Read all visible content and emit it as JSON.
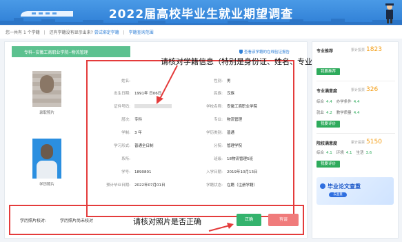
{
  "banner": {
    "title": "2022届高校毕业生就业期望调查"
  },
  "info_row": {
    "count_text": "您一共有",
    "count_num": "1",
    "count_unit": "个学籍",
    "missing_text": "还有学籍没有显示出来?",
    "bind_link": "尝试绑定学籍",
    "query_link": "学籍查询范围"
  },
  "card": {
    "ribbon": "专科--安徽工商职业学院--物流管理",
    "verify_link": "查看该学籍的在线验证报告",
    "photo_caption_1": "录取照片",
    "photo_caption_2": "学历照片",
    "fields": {
      "name_k": "姓名:",
      "name_v": "",
      "gender_k": "性别:",
      "gender_v": "男",
      "dob_k": "出生日期:",
      "dob_v": "1991年  日06日",
      "nation_k": "民族:",
      "nation_v": "汉族",
      "id_k": "证件号码:",
      "school_k": "学校名称:",
      "school_v": "安徽工商职业学院",
      "level_k": "层次:",
      "level_v": "专科",
      "major_k": "专业:",
      "major_v": "物流管理",
      "length_k": "学制:",
      "length_v": "3  年",
      "type_k": "学历类别:",
      "type_v": "普通",
      "form_k": "学习形式:",
      "form_v": "普通全日制",
      "branch_k": "分院:",
      "branch_v": "管理学院",
      "dept_k": "系所:",
      "dept_v": "",
      "class_k": "班级:",
      "class_v": "18物流管理5班",
      "sno_k": "学号:",
      "sno_v": "1890801",
      "enroll_k": "入学日期:",
      "enroll_v": "2019年10月13日",
      "grad_k": "预计毕业日期:",
      "grad_v": "2022年07月01日",
      "status_k": "学籍状态:",
      "status_v": "在籍（注册学籍）"
    },
    "annot_top": "请核对学籍信息（特别是身份证、姓名、专业）",
    "annot_bottom": "请核对照片是否正确",
    "photo_check_label": "学历照片校对:",
    "photo_check_value": "学历照片尚未校对",
    "btn_ok": "正确",
    "btn_err": "有误"
  },
  "sidebar": {
    "s1_title": "专业推荐",
    "s1_count_label": "累计投票",
    "s1_count": "1823",
    "s1_btn": "我要推荐",
    "s2_title": "专业满意度",
    "s2_count_label": "累计投票",
    "s2_count": "326",
    "s2_r1a_k": "综合",
    "s2_r1a_v": "4.4",
    "s2_r1b_k": "办学条件",
    "s2_r1b_v": "4.4",
    "s2_r2a_k": "就业",
    "s2_r2a_v": "4.2",
    "s2_r2b_k": "教学质量",
    "s2_r2b_v": "4.4",
    "s2_btn": "我要评价",
    "s3_title": "院校满意度",
    "s3_count_label": "累计投票",
    "s3_count": "5150",
    "s3_r1a_k": "综合",
    "s3_r1a_v": "4.1",
    "s3_r1b_k": "环境",
    "s3_r1b_v": "4.1",
    "s3_r1c_k": "生活",
    "s3_r1c_v": "3.6",
    "s3_btn": "我要评价",
    "promo_title": "毕业论文查重",
    "promo_search": "去查重"
  },
  "colors": {
    "accent": "#2f7fd6",
    "green": "#2eab5c",
    "red_box": "#e43b3b",
    "orange": "#f39c12"
  }
}
